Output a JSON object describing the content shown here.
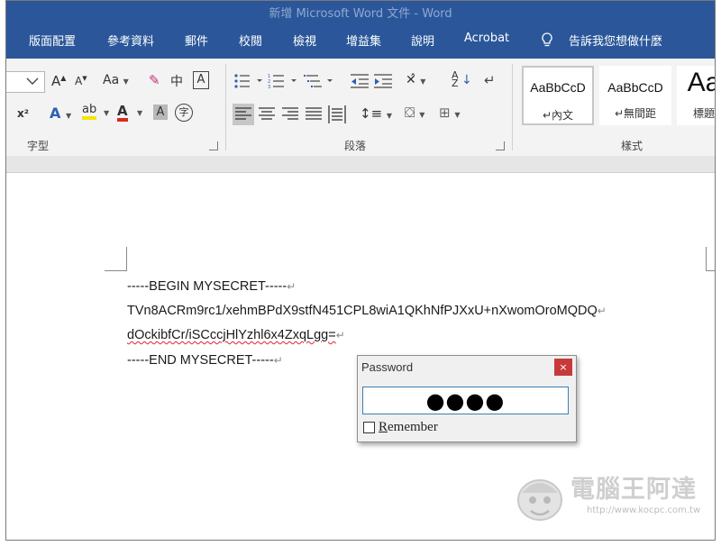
{
  "window": {
    "title": "新增 Microsoft Word 文件 - Word"
  },
  "menu": {
    "items": [
      "版面配置",
      "參考資料",
      "郵件",
      "校閱",
      "檢視",
      "增益集",
      "說明",
      "Acrobat"
    ],
    "tell_me": "告訴我您想做什麼"
  },
  "ribbon": {
    "font_group_label": "字型",
    "paragraph_group_label": "段落",
    "styles_group_label": "樣式",
    "font_buttons": {
      "grow": "A",
      "shrink": "A",
      "change_case": "Aa",
      "phonetic": "中",
      "border_char": "A",
      "superscript": "x²",
      "text_effects": "A",
      "highlight": "ab",
      "font_color": "A",
      "shading": "A",
      "enclose": "字"
    },
    "styles": [
      {
        "sample": "AaBbCcD",
        "name": "↵內文",
        "selected": true
      },
      {
        "sample": "AaBbCcD",
        "name": "↵無間距",
        "selected": false
      },
      {
        "sample": "Aa",
        "name": "標題",
        "selected": false
      }
    ]
  },
  "document": {
    "lines": [
      "-----BEGIN MYSECRET-----",
      "TVn8ACRm9rc1/xehmBPdX9stfN451CPL8wiA1QKhNfPJXxU+nXwomOroMQDQ",
      "dOckibfCr/iSCccjHlYzhl6x4ZxqLgg=",
      "-----END MYSECRET-----"
    ],
    "paragraph_mark": "↵"
  },
  "dialog": {
    "title": "Password",
    "close": "×",
    "password_masked": "●●●●",
    "remember_label": "Remember",
    "remember_checked": false
  },
  "watermark": {
    "title": "電腦王阿達",
    "url": "http://www.kocpc.com.tw"
  },
  "colors": {
    "word_blue": "#2b579a",
    "close_red": "#c83a3a",
    "input_border": "#3c7fb1"
  }
}
